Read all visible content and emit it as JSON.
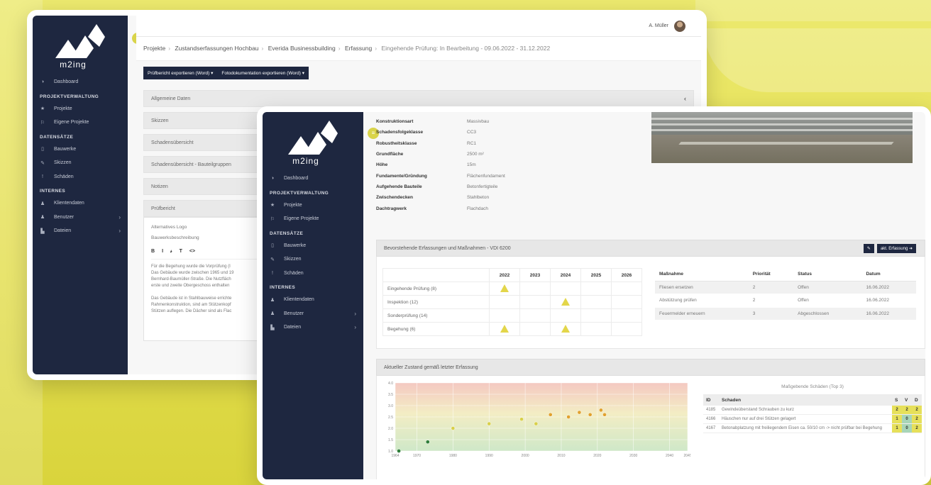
{
  "app": {
    "logo_text": "m2ing",
    "user_name": "A. Müller",
    "toggle_icon": "≡"
  },
  "nav": {
    "dashboard": "Dashboard",
    "section_projects": "PROJEKTVERWALTUNG",
    "projects": "Projekte",
    "own_projects": "Eigene Projekte",
    "section_data": "DATENSÄTZE",
    "buildings": "Bauwerke",
    "sketches": "Skizzen",
    "damages": "Schäden",
    "section_internal": "INTERNES",
    "client_data": "Klientendaten",
    "users": "Benutzer",
    "files": "Dateien"
  },
  "back": {
    "breadcrumb": [
      "Projekte",
      "Zustandserfassungen Hochbau",
      "Everida Businessbuilding",
      "Erfassung",
      "Eingehende Prüfung: In Bearbeitung - 09.06.2022 - 31.12.2022"
    ],
    "export_report": "Prüfbericht exportieren (Word) ▾",
    "export_photo": "Fotodokumentation exportieren (Word) ▾",
    "panels": [
      "Allgemeine Daten",
      "Skizzen",
      "Schadensübersicht",
      "Schadensübersicht - Bauteilgruppen",
      "Notizen",
      "Prüfbericht"
    ],
    "editor_logo_label": "Alternatives Logo",
    "editor_desc_label": "Bauwerksbeschreibung",
    "editor_tools": [
      "B",
      "I",
      "𝓈",
      "T",
      "<>"
    ],
    "editor_lines": [
      "Für die Begehung wurde die Vorprüfung (I",
      "",
      "Das Gebäude wurde zwischen 1965 und 19",
      "Bernhard-Baumüller-Straße. Die Nutzfläch",
      "erste und zweite Obergeschoss enthalten",
      "",
      "Das Gebäude ist in Stahlbauweise errichte",
      "Rahmenkonstruktion, sind am Stützenkopf",
      "Stützen auflegen. Die Dächer sind als Flac"
    ]
  },
  "front": {
    "properties": [
      {
        "k": "Konstruktionsart",
        "v": "Massivbau"
      },
      {
        "k": "Schadensfolgeklasse",
        "v": "CC3"
      },
      {
        "k": "Robustheitsklasse",
        "v": "RC1"
      },
      {
        "k": "Grundfläche",
        "v": "2500 m²"
      },
      {
        "k": "Höhe",
        "v": "15m"
      },
      {
        "k": "Fundamente/Gründung",
        "v": "Flächenfundament"
      },
      {
        "k": "Aufgehende Bauteile",
        "v": "Betonfertigteile"
      },
      {
        "k": "Zwischendecken",
        "v": "Stahlbeton"
      },
      {
        "k": "Dachtragwerk",
        "v": "Flachdach"
      }
    ],
    "section1_title": "Bevorstehende Erfassungen und Maßnahmen - VDI 6200",
    "section1_edit": "✎",
    "section1_button": "akt. Erfassung ➜",
    "years": [
      "2022",
      "2023",
      "2024",
      "2025",
      "2026"
    ],
    "inspections": [
      {
        "label": "Eingehende Prüfung (8)",
        "marks": [
          true,
          false,
          false,
          false,
          false
        ]
      },
      {
        "label": "Inspektion (12)",
        "marks": [
          false,
          false,
          true,
          false,
          false
        ]
      },
      {
        "label": "Sonderprüfung (14)",
        "marks": [
          false,
          false,
          false,
          false,
          false
        ]
      },
      {
        "label": "Begehung (6)",
        "marks": [
          true,
          false,
          true,
          false,
          false
        ]
      }
    ],
    "measures_headers": [
      "Maßnahme",
      "Priorität",
      "Status",
      "Datum"
    ],
    "measures": [
      [
        "Fliesen ersetzen",
        "2",
        "Offen",
        "16.06.2022"
      ],
      [
        "Abstützung prüfen",
        "2",
        "Offen",
        "16.06.2022"
      ],
      [
        "Feuermelder erneuern",
        "3",
        "Abgeschlossen",
        "16.06.2022"
      ]
    ],
    "section2_title": "Aktueller Zustand gemäß letzter Erfassung",
    "damages_title": "Maßgebende Schäden (Top 3)",
    "damages_headers": [
      "ID",
      "Schaden",
      "S",
      "V",
      "D"
    ],
    "damages": [
      {
        "id": "4185",
        "text": "Gewindeüberstand Schrauben zu kurz",
        "s": "2",
        "v": "2",
        "d": "2",
        "vclass": "y"
      },
      {
        "id": "4166",
        "text": "Häuschen nur auf drei Stützen gelagert",
        "s": "1",
        "v": "0",
        "d": "2",
        "vclass": "g"
      },
      {
        "id": "4167",
        "text": "Betonabplatzung mit freiliegendem Eisen ca. 50/10 cm -> nicht prüfbar bei Begehung",
        "s": "1",
        "v": "0",
        "d": "2",
        "vclass": "g"
      }
    ]
  },
  "colors": {
    "sidebar": "#1e2740",
    "accent": "#d9d44a",
    "warn": "#e3d64a"
  },
  "chart_data": {
    "type": "scatter",
    "x_ticks": [
      "1964",
      "1970",
      "1980",
      "1990",
      "2000",
      "2010",
      "2020",
      "2030",
      "2040",
      "2045"
    ],
    "y_ticks": [
      "1.0",
      "1.5",
      "2.0",
      "2.5",
      "3.0",
      "3.5",
      "4.0"
    ],
    "xlim": [
      1964,
      2045
    ],
    "ylim": [
      1.0,
      4.0
    ],
    "background_gradient": "green (low) to red (high)",
    "points": [
      {
        "x": 1965,
        "y": 1.0,
        "color": "#2f7d3a"
      },
      {
        "x": 1973,
        "y": 1.4,
        "color": "#2f7d3a"
      },
      {
        "x": 1980,
        "y": 2.0,
        "color": "#d8d04a"
      },
      {
        "x": 1990,
        "y": 2.2,
        "color": "#d8d04a"
      },
      {
        "x": 1999,
        "y": 2.4,
        "color": "#d8d04a"
      },
      {
        "x": 2003,
        "y": 2.2,
        "color": "#d8d04a"
      },
      {
        "x": 2007,
        "y": 2.6,
        "color": "#e1a22f"
      },
      {
        "x": 2012,
        "y": 2.5,
        "color": "#e1a22f"
      },
      {
        "x": 2015,
        "y": 2.7,
        "color": "#e1a22f"
      },
      {
        "x": 2018,
        "y": 2.6,
        "color": "#e1a22f"
      },
      {
        "x": 2021,
        "y": 2.8,
        "color": "#e1a22f"
      },
      {
        "x": 2022,
        "y": 2.6,
        "color": "#e1a22f"
      }
    ]
  }
}
